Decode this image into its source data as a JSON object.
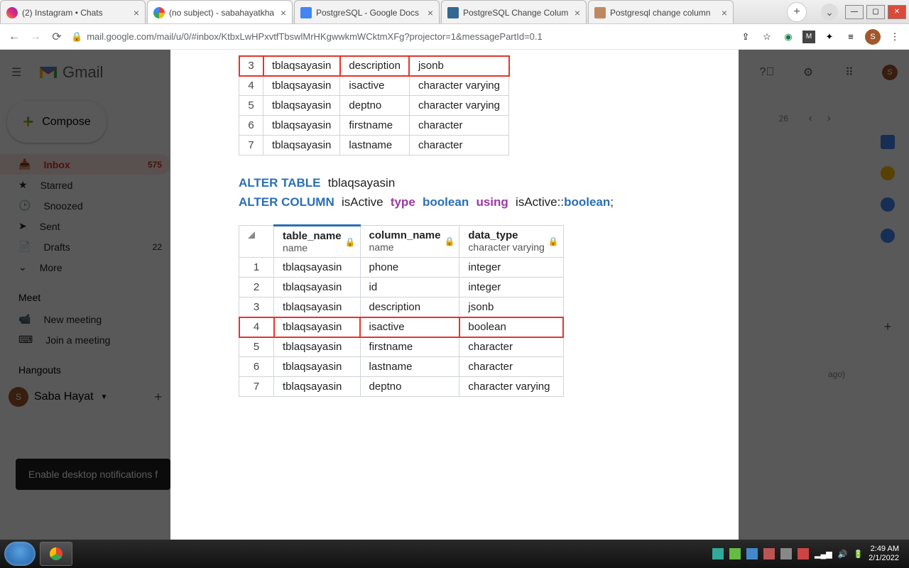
{
  "tabs": [
    {
      "label": "(2) Instagram • Chats"
    },
    {
      "label": "(no subject) - sabahayatkha"
    },
    {
      "label": "PostgreSQL - Google Docs"
    },
    {
      "label": "PostgreSQL Change Colum"
    },
    {
      "label": "Postgresql change column"
    }
  ],
  "url": "mail.google.com/mail/u/0/#inbox/KtbxLwHPxvtfTbswlMrHKgwwkmWCktmXFg?projector=1&messagePartId=0.1",
  "gmail": {
    "logo": "Gmail",
    "compose": "Compose",
    "nav": [
      {
        "label": "Inbox",
        "count": "575",
        "active": true
      },
      {
        "label": "Starred"
      },
      {
        "label": "Snoozed"
      },
      {
        "label": "Sent"
      },
      {
        "label": "Drafts",
        "count": "22"
      },
      {
        "label": "More"
      }
    ],
    "meet_label": "Meet",
    "meet": [
      {
        "label": "New meeting"
      },
      {
        "label": "Join a meeting"
      }
    ],
    "hangouts_label": "Hangouts",
    "user": "Saba Hayat",
    "avatar": "S",
    "notif": "Enable desktop notifications f",
    "ago": "ago)",
    "num": "26"
  },
  "headers": {
    "t": "table_name",
    "ts": "name",
    "c": "column_name",
    "cs": "name",
    "d": "data_type",
    "ds": "character varying"
  },
  "table1": [
    {
      "i": "3",
      "t": "tblaqsayasin",
      "c": "description",
      "d": "jsonb",
      "hl": true
    },
    {
      "i": "4",
      "t": "tblaqsayasin",
      "c": "isactive",
      "d": "character varying"
    },
    {
      "i": "5",
      "t": "tblaqsayasin",
      "c": "deptno",
      "d": "character varying"
    },
    {
      "i": "6",
      "t": "tblaqsayasin",
      "c": "firstname",
      "d": "character"
    },
    {
      "i": "7",
      "t": "tblaqsayasin",
      "c": "lastname",
      "d": "character"
    }
  ],
  "sql": {
    "alter_table": "ALTER TABLE",
    "tbl": "tblaqsayasin",
    "alter_col": "ALTER COLUMN",
    "col": "isActive",
    "type": "type",
    "dtype": "boolean",
    "using": "using",
    "expr": "isActive::",
    "cast": "boolean",
    ";": ";"
  },
  "table2": [
    {
      "i": "1",
      "t": "tblaqsayasin",
      "c": "phone",
      "d": "integer"
    },
    {
      "i": "2",
      "t": "tblaqsayasin",
      "c": "id",
      "d": "integer"
    },
    {
      "i": "3",
      "t": "tblaqsayasin",
      "c": "description",
      "d": "jsonb"
    },
    {
      "i": "4",
      "t": "tblaqsayasin",
      "c": "isactive",
      "d": "boolean",
      "hl": true
    },
    {
      "i": "5",
      "t": "tblaqsayasin",
      "c": "firstname",
      "d": "character"
    },
    {
      "i": "6",
      "t": "tblaqsayasin",
      "c": "lastname",
      "d": "character"
    },
    {
      "i": "7",
      "t": "tblaqsayasin",
      "c": "deptno",
      "d": "character varying"
    }
  ],
  "clock": {
    "time": "2:49 AM",
    "date": "2/1/2022"
  }
}
